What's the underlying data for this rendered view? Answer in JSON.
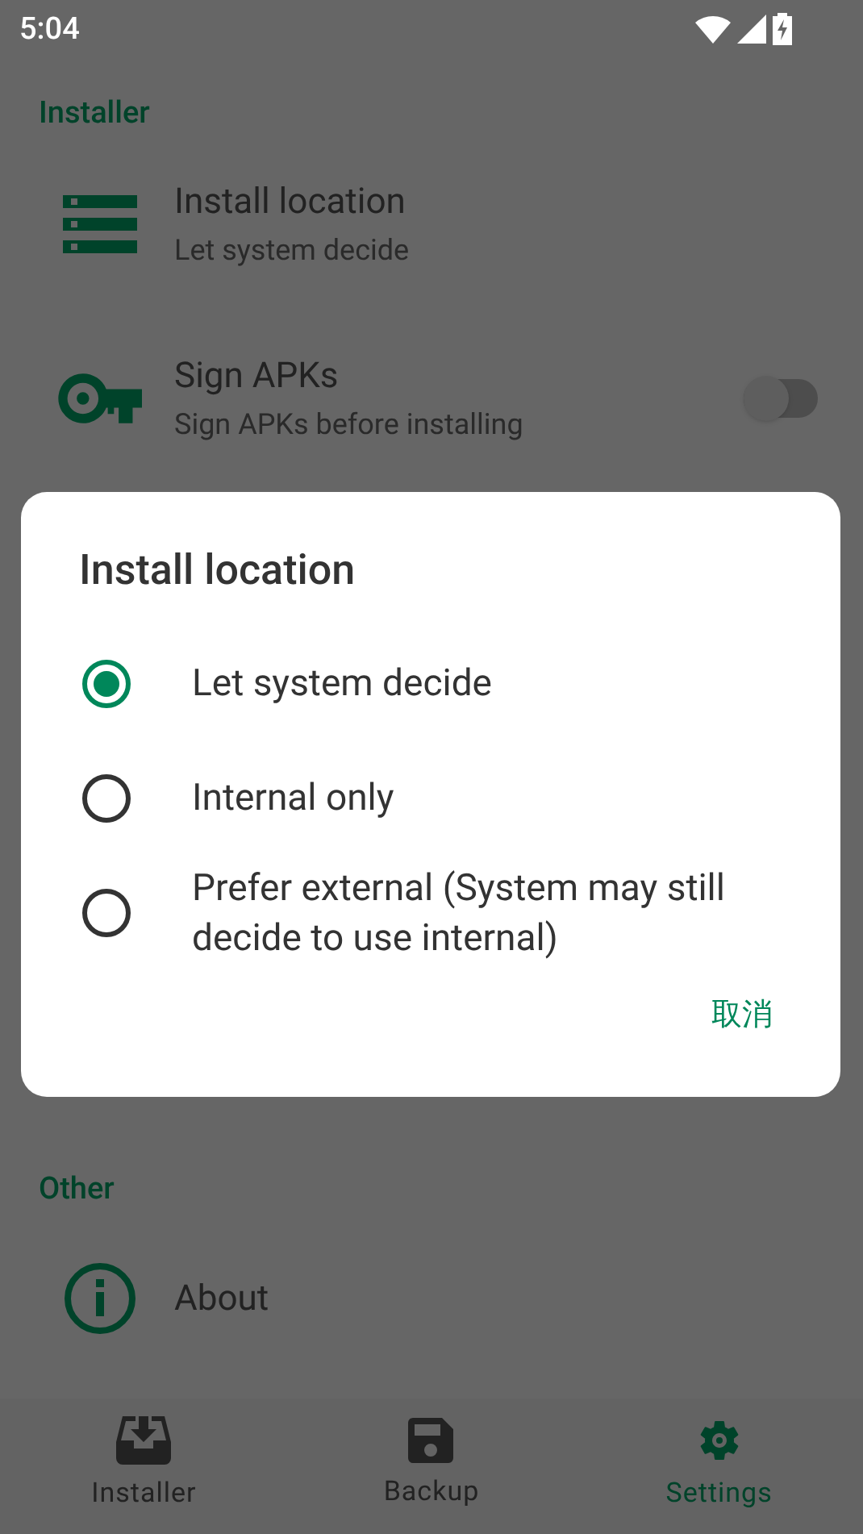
{
  "status_bar": {
    "time": "5:04"
  },
  "sections": [
    {
      "title": "Installer",
      "items": [
        {
          "kind": "location",
          "title": "Install location",
          "summary": "Let system decide"
        },
        {
          "kind": "sign",
          "title": "Sign APKs",
          "summary": "Sign APKs before installing",
          "on": false
        }
      ]
    },
    {
      "title": "Other",
      "items": [
        {
          "kind": "about",
          "title": "About"
        }
      ]
    }
  ],
  "dialog": {
    "title": "Install location",
    "options": [
      {
        "label": "Let system decide",
        "selected": true
      },
      {
        "label": "Internal only",
        "selected": false
      },
      {
        "label": "Prefer external (System may still decide to use internal)",
        "selected": false
      }
    ],
    "buttons": [
      "取消"
    ]
  },
  "bottom_nav": [
    {
      "kind": "installer",
      "label": "Installer",
      "selected": false
    },
    {
      "kind": "backup",
      "label": "Backup",
      "selected": false
    },
    {
      "kind": "settings",
      "label": "Settings",
      "selected": true
    }
  ]
}
